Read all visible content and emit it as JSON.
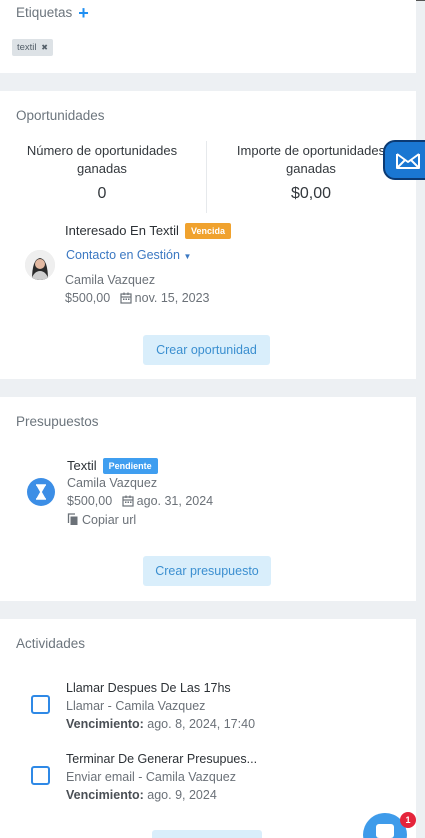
{
  "etiquetas": {
    "title": "Etiquetas",
    "add_symbol": "+",
    "tags": [
      {
        "label": "textil",
        "remove": "✖"
      }
    ]
  },
  "oportunidades": {
    "title": "Oportunidades",
    "won_count_label": "Número de oportunidades ganadas",
    "won_count_value": "0",
    "won_amount_label": "Importe de oportunidades ganadas",
    "won_amount_value": "$0,00",
    "item": {
      "name": "Interesado En Textil",
      "badge": "Vencida",
      "stage": "Contacto en Gestión",
      "contact": "Camila Vazquez",
      "amount": "$500,00",
      "date": "nov. 15, 2023"
    },
    "create_button": "Crear oportunidad"
  },
  "presupuestos": {
    "title": "Presupuestos",
    "item": {
      "name": "Textil",
      "badge": "Pendiente",
      "contact": "Camila Vazquez",
      "amount": "$500,00",
      "date": "ago. 31, 2024",
      "copy_label": "Copiar url"
    },
    "create_button": "Crear presupuesto"
  },
  "actividades": {
    "title": "Actividades",
    "due_label": "Vencimiento:",
    "items": [
      {
        "title": "Llamar Despues De Las 17hs",
        "subtitle": "Llamar - Camila Vazquez",
        "due": "ago. 8, 2024, 17:40"
      },
      {
        "title": "Terminar De Generar Presupues...",
        "subtitle": "Enviar email - Camila Vazquez",
        "due": "ago. 9, 2024"
      }
    ]
  },
  "chat": {
    "badge_count": "1"
  },
  "colors": {
    "accent": "#1f8ff2",
    "overdue": "#f0a22e",
    "pending": "#3f9ef0",
    "button_bg": "#d9eefb"
  }
}
